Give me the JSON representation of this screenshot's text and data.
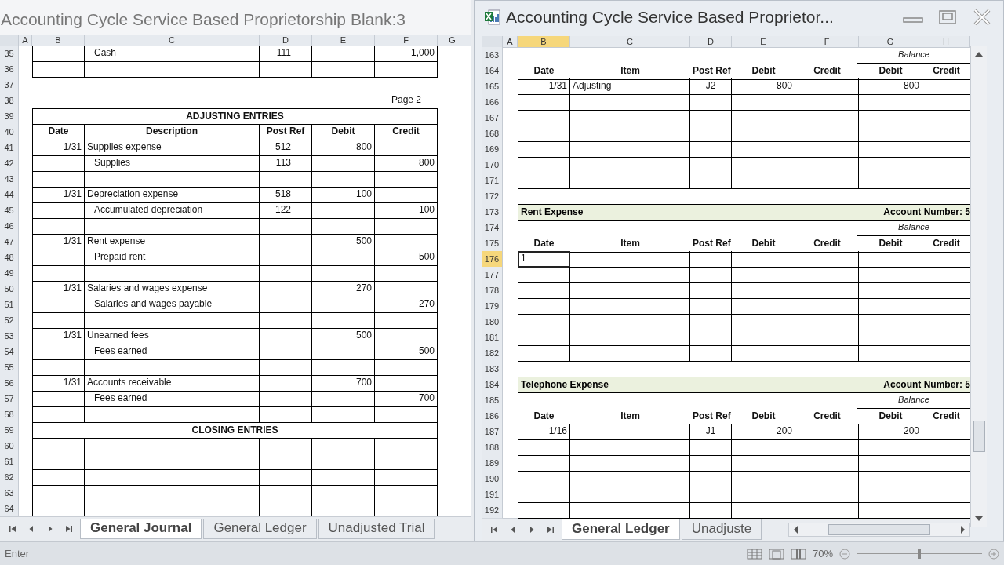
{
  "left": {
    "title": "Accounting Cycle Service Based Proprietorship Blank:3",
    "columns": [
      "A",
      "B",
      "C",
      "D",
      "E",
      "F",
      "G"
    ],
    "rows": [
      {
        "num": "35",
        "kind": "entry",
        "description": "Cash",
        "indented": true,
        "post_ref": "111",
        "credit": "1,000"
      },
      {
        "num": "36",
        "kind": "entry"
      },
      {
        "num": "37",
        "kind": "gap"
      },
      {
        "num": "38",
        "kind": "page",
        "page_label": "Page 2"
      },
      {
        "num": "39",
        "kind": "title",
        "text": "ADJUSTING ENTRIES"
      },
      {
        "num": "40",
        "kind": "header",
        "labels": [
          "Date",
          "Description",
          "Post Ref",
          "Debit",
          "Credit"
        ]
      },
      {
        "num": "41",
        "kind": "entry",
        "date": "1/31",
        "description": "Supplies expense",
        "indented": false,
        "post_ref": "512",
        "debit": "800"
      },
      {
        "num": "42",
        "kind": "entry",
        "description": "Supplies",
        "indented": true,
        "post_ref": "113",
        "credit": "800"
      },
      {
        "num": "43",
        "kind": "entry"
      },
      {
        "num": "44",
        "kind": "entry",
        "date": "1/31",
        "description": "Depreciation expense",
        "indented": false,
        "post_ref": "518",
        "debit": "100"
      },
      {
        "num": "45",
        "kind": "entry",
        "description": "Accumulated depreciation",
        "indented": true,
        "post_ref": "122",
        "credit": "100"
      },
      {
        "num": "46",
        "kind": "entry"
      },
      {
        "num": "47",
        "kind": "entry",
        "date": "1/31",
        "description": "Rent expense",
        "indented": false,
        "debit": "500"
      },
      {
        "num": "48",
        "kind": "entry",
        "description": "Prepaid rent",
        "indented": true,
        "credit": "500"
      },
      {
        "num": "49",
        "kind": "entry"
      },
      {
        "num": "50",
        "kind": "entry",
        "date": "1/31",
        "description": "Salaries and wages expense",
        "indented": false,
        "debit": "270"
      },
      {
        "num": "51",
        "kind": "entry",
        "description": "Salaries and wages payable",
        "indented": true,
        "credit": "270"
      },
      {
        "num": "52",
        "kind": "entry"
      },
      {
        "num": "53",
        "kind": "entry",
        "date": "1/31",
        "description": "Unearned fees",
        "indented": false,
        "debit": "500"
      },
      {
        "num": "54",
        "kind": "entry",
        "description": "Fees earned",
        "indented": true,
        "credit": "500"
      },
      {
        "num": "55",
        "kind": "entry"
      },
      {
        "num": "56",
        "kind": "entry",
        "date": "1/31",
        "description": "Accounts receivable",
        "indented": false,
        "debit": "700"
      },
      {
        "num": "57",
        "kind": "entry",
        "description": "Fees earned",
        "indented": true,
        "credit": "700"
      },
      {
        "num": "58",
        "kind": "entry"
      },
      {
        "num": "59",
        "kind": "title",
        "text": "CLOSING ENTRIES"
      },
      {
        "num": "60",
        "kind": "entry"
      },
      {
        "num": "61",
        "kind": "entry"
      },
      {
        "num": "62",
        "kind": "entry"
      },
      {
        "num": "63",
        "kind": "entry"
      },
      {
        "num": "64",
        "kind": "entry"
      }
    ],
    "tabs": [
      {
        "label": "General Journal",
        "selected": true
      },
      {
        "label": "General Ledger",
        "selected": false
      },
      {
        "label": "Unadjusted Trial",
        "selected": false
      }
    ]
  },
  "right": {
    "title": "Accounting Cycle Service Based Proprietor...",
    "columns": [
      {
        "label": "A",
        "selected": false
      },
      {
        "label": "B",
        "selected": true
      },
      {
        "label": "C",
        "selected": false
      },
      {
        "label": "D",
        "selected": false
      },
      {
        "label": "E",
        "selected": false
      },
      {
        "label": "F",
        "selected": false
      },
      {
        "label": "G",
        "selected": false
      },
      {
        "label": "H",
        "selected": false
      }
    ],
    "rows": [
      {
        "num": "163",
        "kind": "balance",
        "text": "Balance",
        "selected": false
      },
      {
        "num": "164",
        "kind": "header",
        "labels": [
          "Date",
          "Item",
          "Post Ref",
          "Debit",
          "Credit",
          "Debit",
          "Credit"
        ],
        "selected": false
      },
      {
        "num": "165",
        "kind": "entry",
        "date": "1/31",
        "item": "Adjusting",
        "post_ref": "J2",
        "debit": "800",
        "balance_debit": "800",
        "selected": false
      },
      {
        "num": "166",
        "kind": "entry",
        "selected": false
      },
      {
        "num": "167",
        "kind": "entry",
        "selected": false
      },
      {
        "num": "168",
        "kind": "entry",
        "selected": false
      },
      {
        "num": "169",
        "kind": "entry",
        "selected": false
      },
      {
        "num": "170",
        "kind": "entry",
        "selected": false
      },
      {
        "num": "171",
        "kind": "entry",
        "selected": false
      },
      {
        "num": "172",
        "kind": "gap",
        "selected": false
      },
      {
        "num": "173",
        "kind": "account",
        "name": "Rent Expense",
        "number": "Account Number: 5",
        "selected": false
      },
      {
        "num": "174",
        "kind": "balance",
        "text": "Balance",
        "selected": false
      },
      {
        "num": "175",
        "kind": "header",
        "labels": [
          "Date",
          "Item",
          "Post Ref",
          "Debit",
          "Credit",
          "Debit",
          "Credit"
        ],
        "selected": false
      },
      {
        "num": "176",
        "kind": "entry",
        "typed": "1",
        "selected": true
      },
      {
        "num": "177",
        "kind": "entry",
        "selected": false
      },
      {
        "num": "178",
        "kind": "entry",
        "selected": false
      },
      {
        "num": "179",
        "kind": "entry",
        "selected": false
      },
      {
        "num": "180",
        "kind": "entry",
        "selected": false
      },
      {
        "num": "181",
        "kind": "entry",
        "selected": false
      },
      {
        "num": "182",
        "kind": "entry",
        "selected": false
      },
      {
        "num": "183",
        "kind": "gap",
        "selected": false
      },
      {
        "num": "184",
        "kind": "account",
        "name": "Telephone Expense",
        "number": "Account Number: 5",
        "selected": false
      },
      {
        "num": "185",
        "kind": "balance",
        "text": "Balance",
        "selected": false
      },
      {
        "num": "186",
        "kind": "header",
        "labels": [
          "Date",
          "Item",
          "Post Ref",
          "Debit",
          "Credit",
          "Debit",
          "Credit"
        ],
        "selected": false
      },
      {
        "num": "187",
        "kind": "entry",
        "date": "1/16",
        "post_ref": "J1",
        "debit": "200",
        "balance_debit": "200",
        "selected": false
      },
      {
        "num": "188",
        "kind": "entry",
        "selected": false
      },
      {
        "num": "189",
        "kind": "entry",
        "selected": false
      },
      {
        "num": "190",
        "kind": "entry",
        "selected": false
      },
      {
        "num": "191",
        "kind": "entry",
        "selected": false
      },
      {
        "num": "192",
        "kind": "entry",
        "selected": false
      }
    ],
    "tabs": [
      {
        "label": "General Ledger",
        "selected": true
      },
      {
        "label": "Unadjuste",
        "selected": false
      }
    ]
  },
  "status_bar": {
    "mode": "Enter",
    "zoom": "70%",
    "zoom_slider": {
      "level": 0.5
    }
  }
}
